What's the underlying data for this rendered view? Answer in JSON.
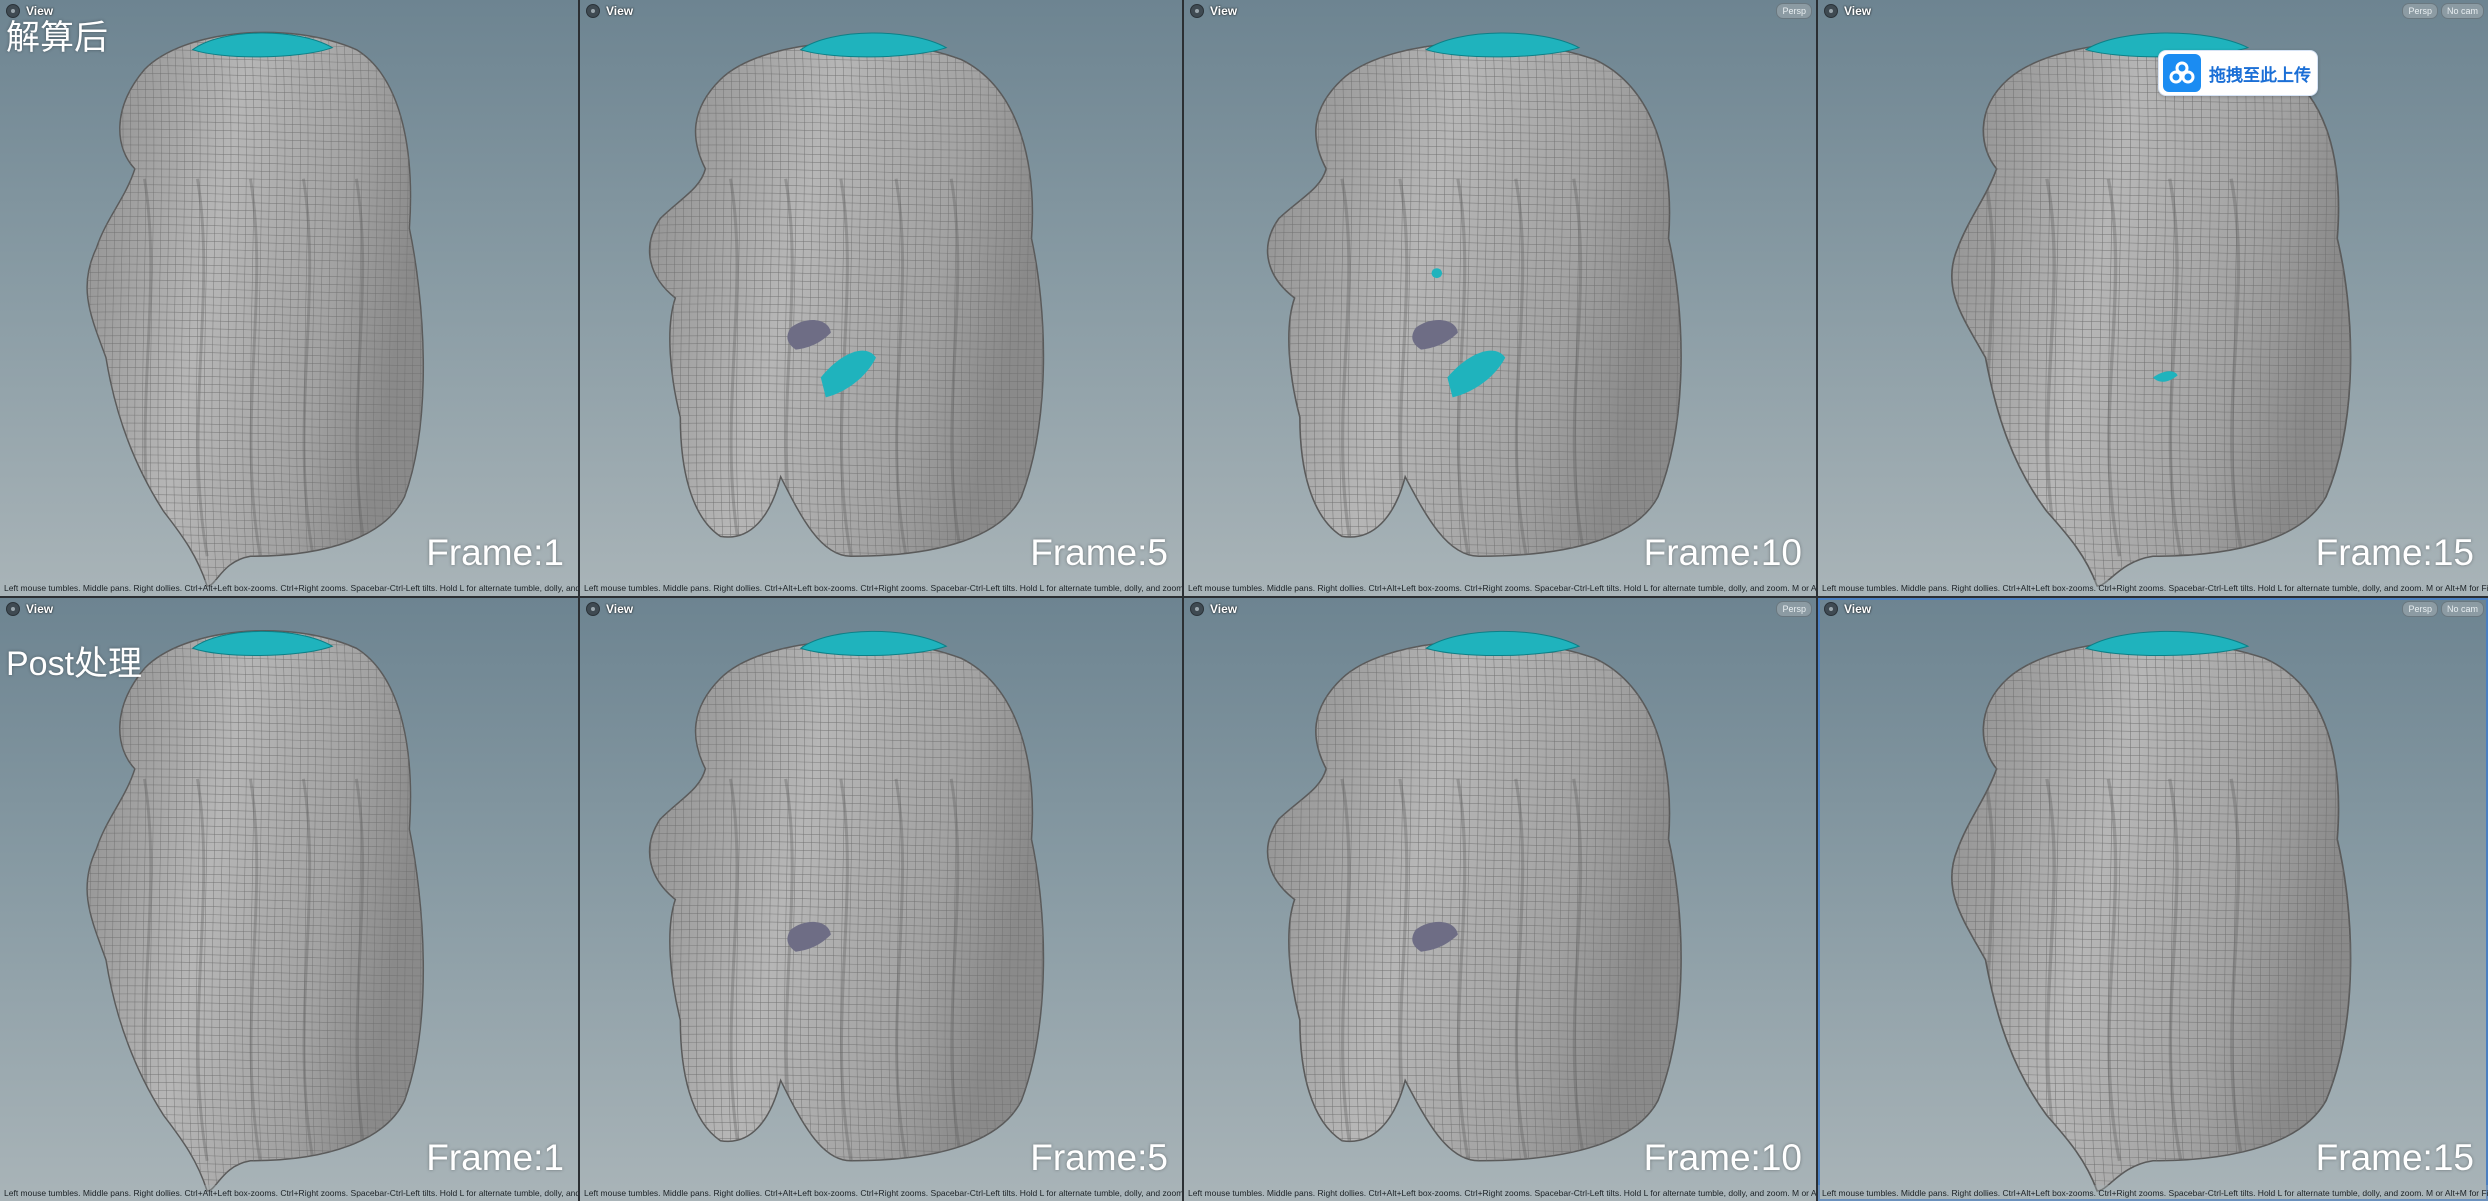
{
  "row_titles": [
    "解算后",
    "Post处理"
  ],
  "view_label": "View",
  "camera_buttons": {
    "persp": "Persp",
    "nocam": "No cam"
  },
  "hint_text": "Left mouse tumbles. Middle pans. Right dollies. Ctrl+Alt+Left box-zooms. Ctrl+Right zooms. Spacebar-Ctrl-Left tilts. Hold L for alternate tumble, dolly, and zoom. M or Alt+M for First Person Navigation.",
  "frames": {
    "f1": "Frame:1",
    "f5": "Frame:5",
    "f10": "Frame:10",
    "f15": "Frame:15"
  },
  "upload_badge": {
    "label": "拖拽至此上传",
    "icon": "cloud-upload-icon"
  },
  "colors": {
    "viewport_top": "#6d8491",
    "viewport_bottom": "#a9b4b8",
    "mesh_gray": "#a7a7a7",
    "cap_teal": "#1fb3bd",
    "intersection_purple": "#6e6d85"
  }
}
